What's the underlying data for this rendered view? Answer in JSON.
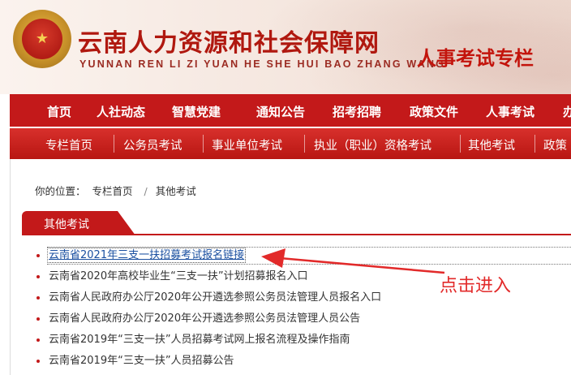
{
  "header": {
    "site_title": "云南人力资源和社会保障网",
    "site_subtitle": "YUNNAN REN LI ZI YUAN HE SHE HUI BAO ZHANG WANG",
    "column_title": "人事考试专栏",
    "emblem_icon": "national-emblem-icon"
  },
  "main_nav": {
    "items": [
      "首页",
      "人社动态",
      "智慧党建",
      "通知公告",
      "招考招聘",
      "政策文件",
      "人事考试",
      "办"
    ]
  },
  "sub_nav": {
    "items": [
      "专栏首页",
      "公务员考试",
      "事业单位考试",
      "执业（职业）资格考试",
      "其他考试",
      "政策"
    ]
  },
  "breadcrumb": {
    "label": "你的位置：",
    "home": "专栏首页",
    "separator": "/",
    "current": "其他考试"
  },
  "section": {
    "title": "其他考试"
  },
  "news": [
    "云南省2021年三支一扶招募考试报名链接",
    "云南省2020年高校毕业生“三支一扶”计划招募报名入口",
    "云南省人民政府办公厅2020年公开遴选参照公务员法管理人员报名入口",
    "云南省人民政府办公厅2020年公开遴选参照公务员法管理人员公告",
    "云南省2019年“三支一扶”人员招募考试网上报名流程及操作指南",
    "云南省2019年“三支一扶”人员招募公告"
  ],
  "annotation": {
    "text": "点击进入"
  },
  "colors": {
    "brand_red": "#c3191a",
    "title_red": "#b0180f",
    "link_blue": "#1a4fa0",
    "annotation_red": "#e22a2a"
  }
}
